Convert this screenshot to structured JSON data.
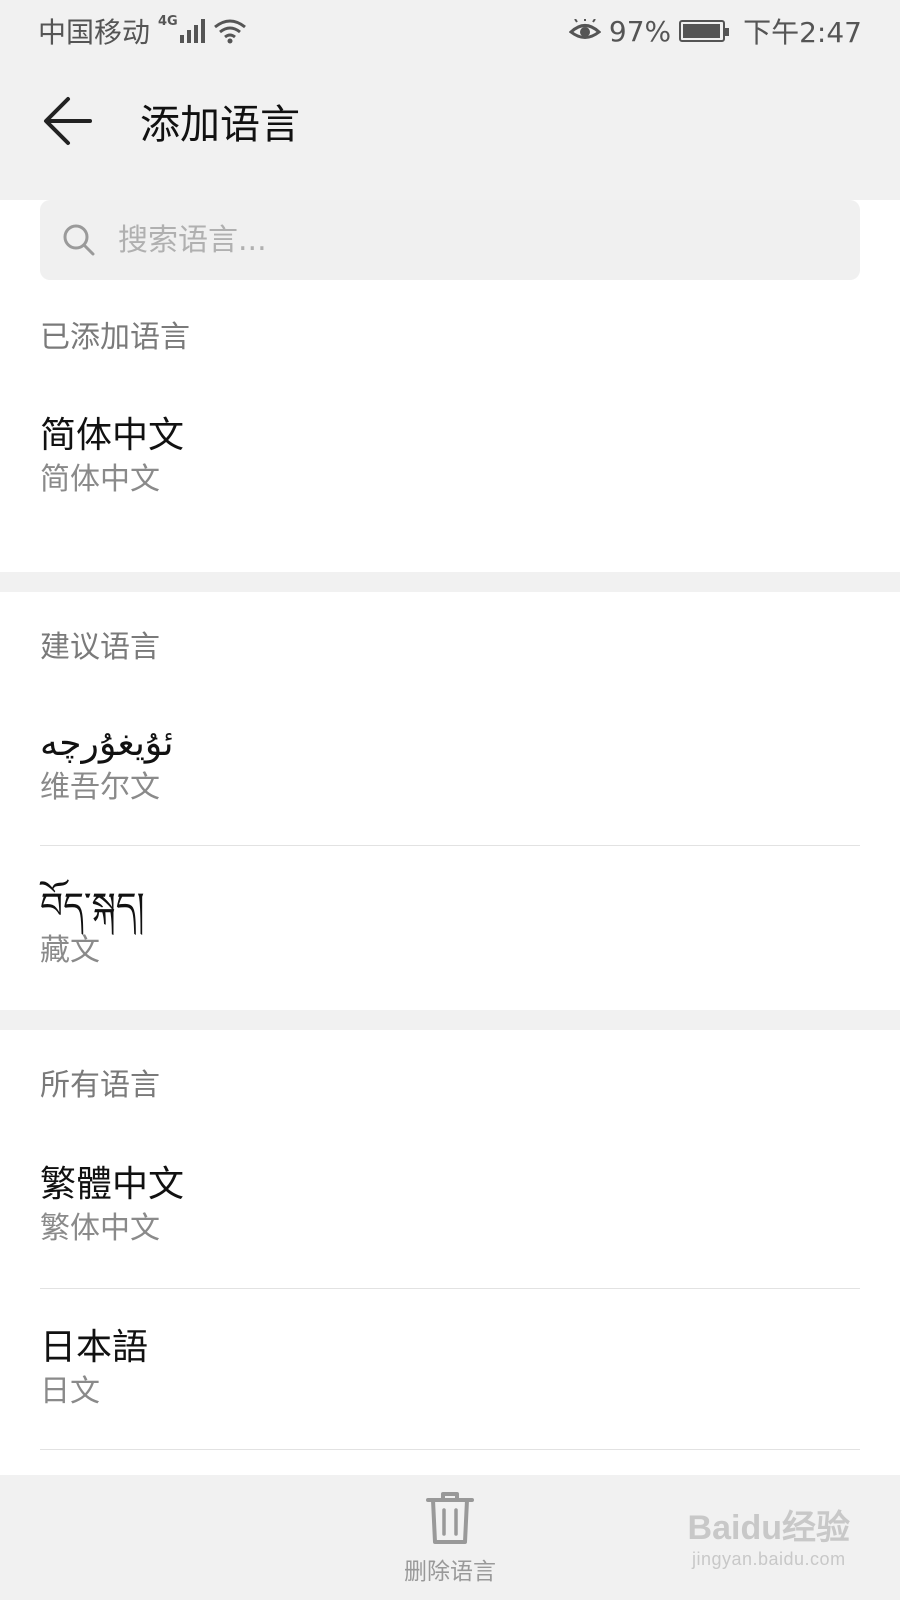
{
  "status_bar": {
    "carrier": "中国移动",
    "network_type": "4G",
    "battery_percent": "97%",
    "battery_level": 0.97,
    "time": "下午2:47"
  },
  "header": {
    "title": "添加语言"
  },
  "search": {
    "placeholder": "搜索语言..."
  },
  "sections": {
    "added": {
      "title": "已添加语言",
      "items": [
        {
          "primary": "简体中文",
          "secondary": "简体中文"
        }
      ]
    },
    "suggested": {
      "title": "建议语言",
      "items": [
        {
          "primary": "ئۇيغۇرچە",
          "secondary": "维吾尔文"
        },
        {
          "primary": "བོད་སྐད།",
          "secondary": "藏文"
        }
      ]
    },
    "all": {
      "title": "所有语言",
      "items": [
        {
          "primary": "繁體中文",
          "secondary": "繁体中文"
        },
        {
          "primary": "日本語",
          "secondary": "日文"
        }
      ]
    }
  },
  "bottom_bar": {
    "delete_label": "删除语言"
  },
  "watermark": {
    "brand": "Baidu经验",
    "url": "jingyan.baidu.com"
  },
  "icons": {
    "back": "back-arrow-icon",
    "search": "search-icon",
    "delete": "trash-icon",
    "eye_comfort": "eye-icon",
    "wifi": "wifi-icon",
    "signal": "signal-icon",
    "battery": "battery-icon"
  }
}
